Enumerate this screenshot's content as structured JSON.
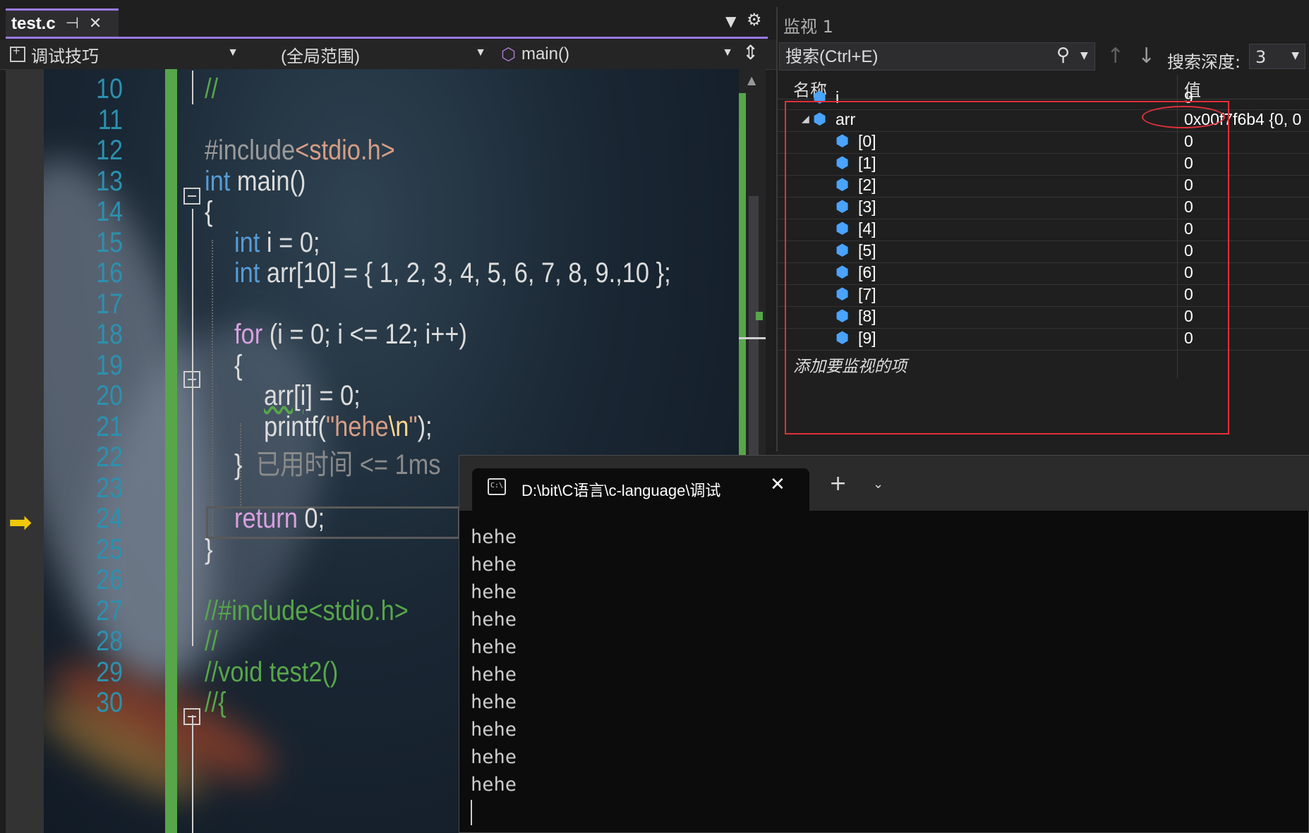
{
  "editor": {
    "tab_name": "test.c",
    "nav": {
      "project": "调试技巧",
      "scope": "(全局范围)",
      "function": "main()"
    },
    "line_numbers": [
      "10",
      "11",
      "12",
      "13",
      "14",
      "15",
      "16",
      "17",
      "18",
      "19",
      "20",
      "21",
      "22",
      "23",
      "24",
      "25",
      "26",
      "27",
      "28",
      "29",
      "30"
    ],
    "code": {
      "l10": "//",
      "l12_pre": "#include",
      "l12_hdr": "<stdio.h>",
      "l13_kw": "int",
      "l13_rest": " main()",
      "l14": "{",
      "l15_kw": "int",
      "l15_rest": " i = 0;",
      "l16_kw": "int",
      "l16_rest": " arr[10] = { 1, 2, 3, 4, 5, 6, 7, 8, 9.,10 };",
      "l18_kw": "for",
      "l18_rest": " (i = 0; i <= 12; i++)",
      "l19": "{",
      "l20_arr": "arr[i]",
      "l20_rest": " = 0;",
      "l21_fn": "printf(",
      "l21_str1": "\"hehe",
      "l21_esc": "\\n",
      "l21_str2": "\"",
      "l21_end": ");",
      "l22_brace": "}",
      "l22_hint": "已用时间 <= 1ms",
      "l24_kw": "return",
      "l24_rest": " 0;",
      "l25": "}",
      "l27": "//#include<stdio.h>",
      "l28": "//",
      "l29": "//void test2()",
      "l30": "//{"
    }
  },
  "watch": {
    "title": "监视 1",
    "search_placeholder": "搜索(Ctrl+E)",
    "depth_label": "搜索深度:",
    "depth_value": "3",
    "col_name": "名称",
    "col_value": "值",
    "rows": [
      {
        "name": "i",
        "value": "9"
      },
      {
        "name": "arr",
        "value": "0x00f7f6b4 {0, 0"
      },
      {
        "name": "[0]",
        "value": "0"
      },
      {
        "name": "[1]",
        "value": "0"
      },
      {
        "name": "[2]",
        "value": "0"
      },
      {
        "name": "[3]",
        "value": "0"
      },
      {
        "name": "[4]",
        "value": "0"
      },
      {
        "name": "[5]",
        "value": "0"
      },
      {
        "name": "[6]",
        "value": "0"
      },
      {
        "name": "[7]",
        "value": "0"
      },
      {
        "name": "[8]",
        "value": "0"
      },
      {
        "name": "[9]",
        "value": "0"
      }
    ],
    "add_item": "添加要监视的项"
  },
  "terminal": {
    "tab_title": "D:\\bit\\C语言\\c-language\\调试",
    "output": [
      "hehe",
      "hehe",
      "hehe",
      "hehe",
      "hehe",
      "hehe",
      "hehe",
      "hehe",
      "hehe",
      "hehe"
    ]
  },
  "colors": {
    "accent": "#9b7ae6",
    "change_bar": "#57a64a",
    "highlight_red": "#e0303a",
    "exec_arrow": "#f0c808"
  }
}
